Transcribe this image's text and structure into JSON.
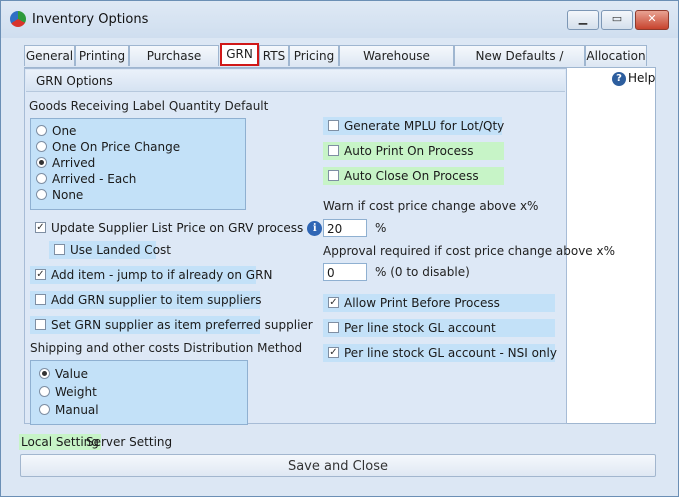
{
  "window": {
    "title": "Inventory Options",
    "controls": {
      "minimize": "▁",
      "maximize": "▭",
      "close": "✕"
    }
  },
  "tabs": [
    {
      "label": "General"
    },
    {
      "label": "Printing"
    },
    {
      "label": "Purchase Order"
    },
    {
      "label": "GRN",
      "active": true
    },
    {
      "label": "RTS"
    },
    {
      "label": "Pricing"
    },
    {
      "label": "Warehouse Transfer"
    },
    {
      "label": "New Defaults / Required"
    },
    {
      "label": "Allocation"
    }
  ],
  "help": {
    "label": "Help"
  },
  "grn": {
    "section_title": "GRN Options",
    "label_qty_title": "Goods Receiving Label Quantity Default",
    "label_qty_options": [
      {
        "label": "One",
        "selected": false
      },
      {
        "label": "One On Price Change",
        "selected": false
      },
      {
        "label": "Arrived",
        "selected": true
      },
      {
        "label": "Arrived - Each",
        "selected": false
      },
      {
        "label": "None",
        "selected": false
      }
    ],
    "update_supplier_price": {
      "label": "Update Supplier List Price on GRV process",
      "checked": true
    },
    "use_landed_cost": {
      "label": "Use Landed Cost",
      "checked": false
    },
    "add_item_jump": {
      "label": "Add item - jump to if already on GRN",
      "checked": true
    },
    "add_grn_supplier": {
      "label": "Add GRN supplier to item suppliers",
      "checked": false
    },
    "set_preferred_supplier": {
      "label": "Set GRN supplier as item preferred supplier",
      "checked": false
    },
    "shipping_title": "Shipping and other costs Distribution Method",
    "shipping_options": [
      {
        "label": "Value",
        "selected": true
      },
      {
        "label": "Weight",
        "selected": false
      },
      {
        "label": "Manual",
        "selected": false
      }
    ],
    "generate_mplu": {
      "label": "Generate MPLU for Lot/Qty",
      "checked": false
    },
    "auto_print": {
      "label": "Auto Print On Process",
      "checked": false
    },
    "auto_close": {
      "label": "Auto Close On Process",
      "checked": false
    },
    "warn_label": "Warn if cost price change above x%",
    "warn_value": "20",
    "warn_unit": "%",
    "approval_label": "Approval required if cost price change above x%",
    "approval_value": "0",
    "approval_unit": "% (0 to disable)",
    "allow_print_before": {
      "label": "Allow Print Before Process",
      "checked": true
    },
    "per_line_gl": {
      "label": "Per line stock GL account",
      "checked": false
    },
    "per_line_gl_nsi": {
      "label": "Per line stock GL account - NSI only",
      "checked": true
    }
  },
  "footer": {
    "local_setting": "Local Setting",
    "server_setting": "Server Setting",
    "save_close": "Save and Close"
  },
  "colors": {
    "local_highlight": "#c7f4c7",
    "option_box": "#c3e1f8",
    "active_tab_border": "#d01818"
  }
}
